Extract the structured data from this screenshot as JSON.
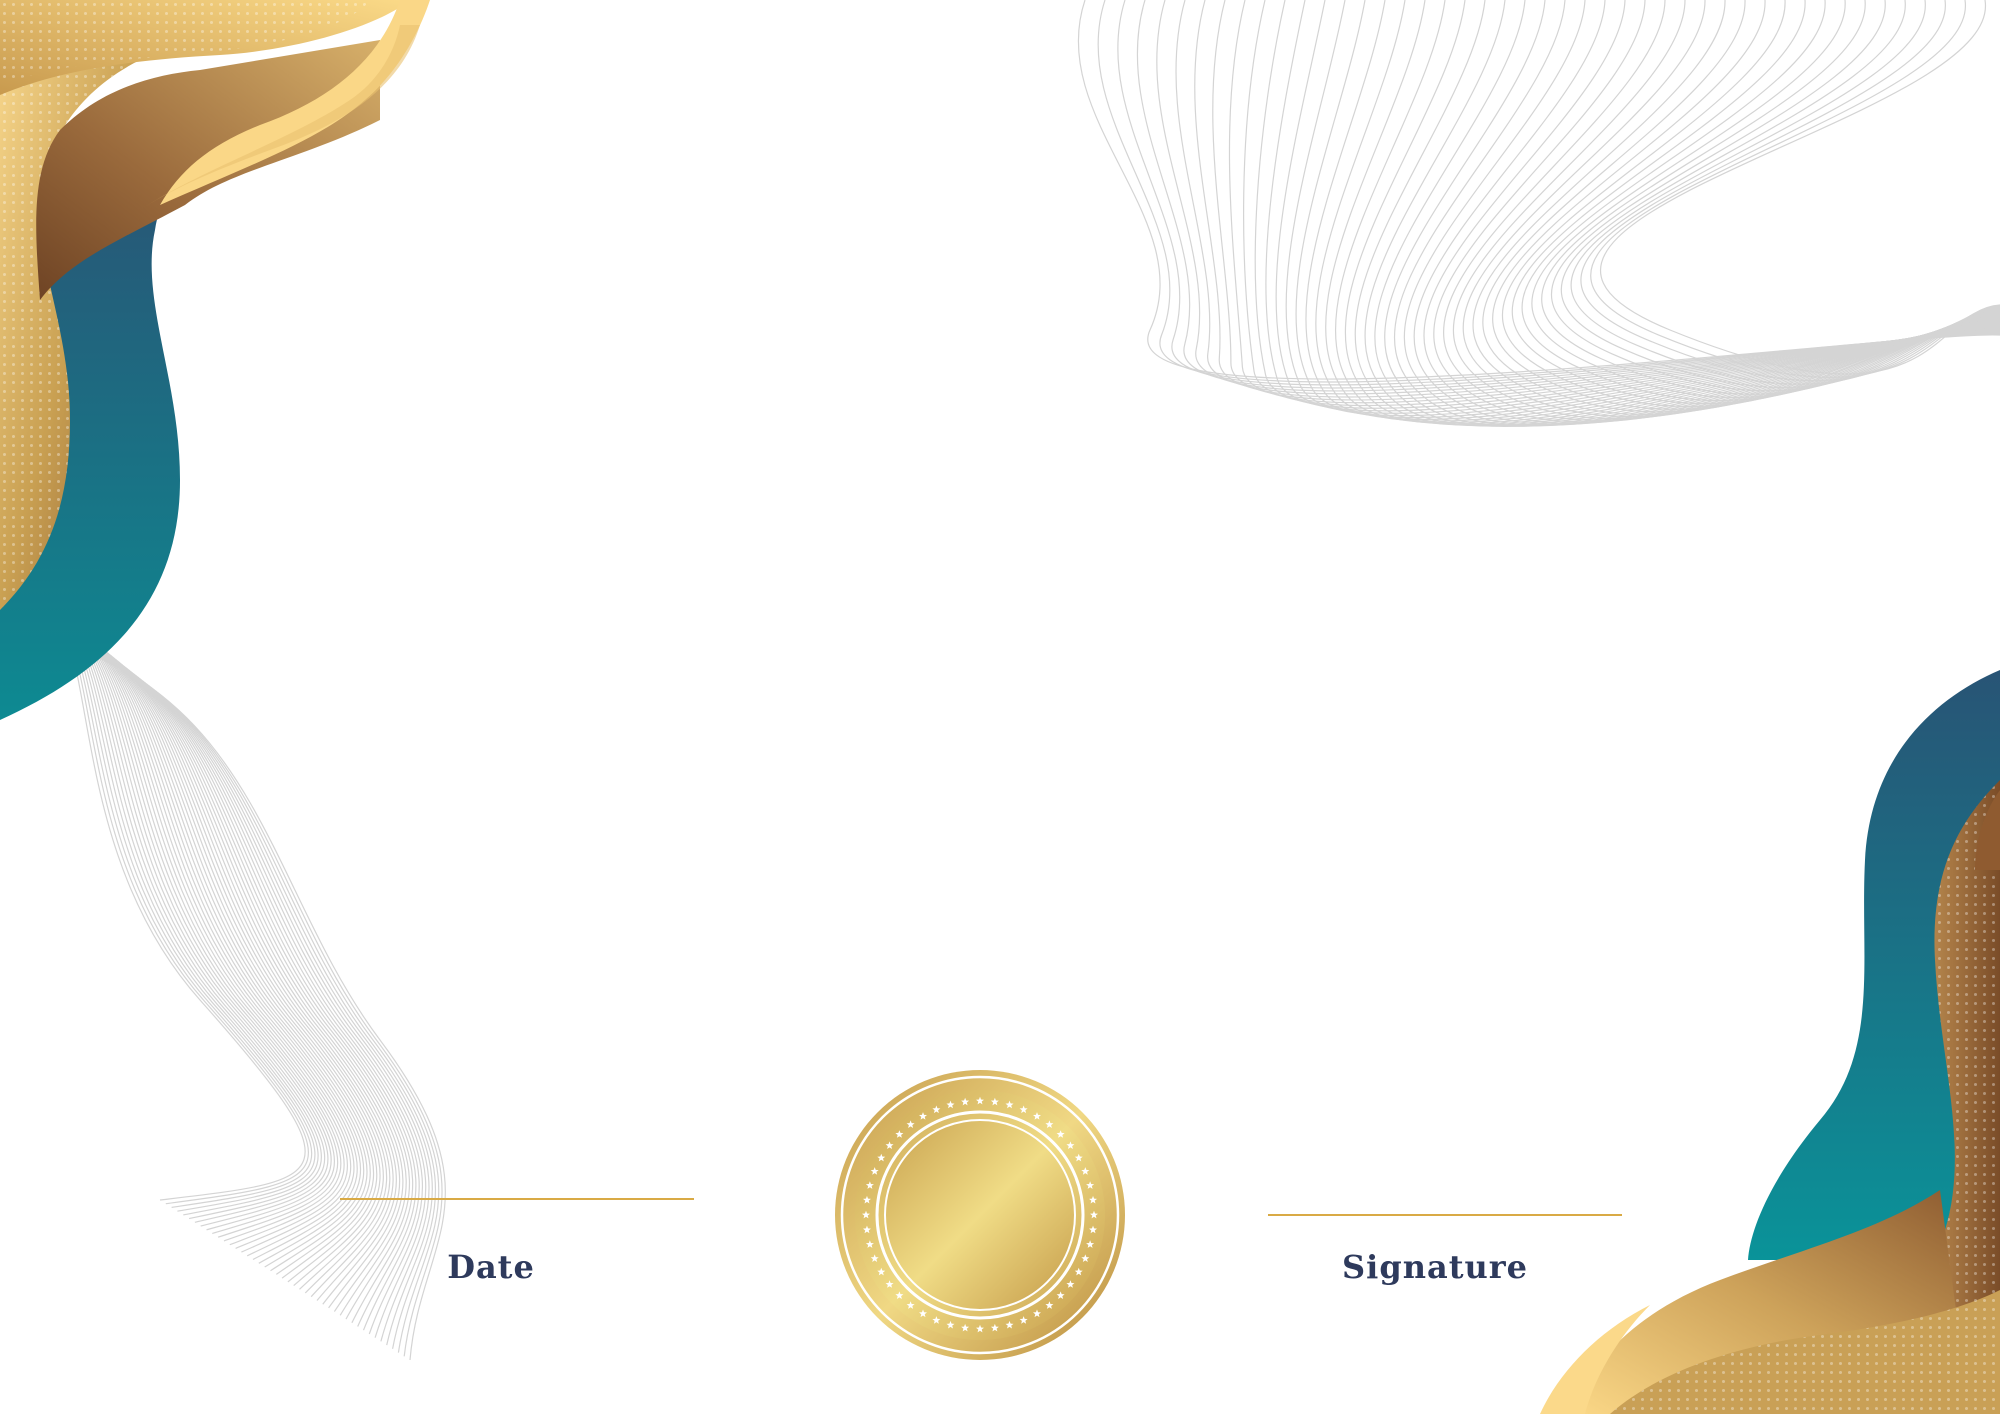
{
  "certificate": {
    "date_label": "Date",
    "signature_label": "Signature"
  },
  "colors": {
    "navy_text": "#2e3a5c",
    "gold_line": "#d9aa45",
    "gold_light": "#f8d98a",
    "gold_dark": "#8a5a30",
    "teal": "#0e8f96",
    "teal_dark": "#27536f",
    "wire_gray": "#d4d4d4"
  }
}
